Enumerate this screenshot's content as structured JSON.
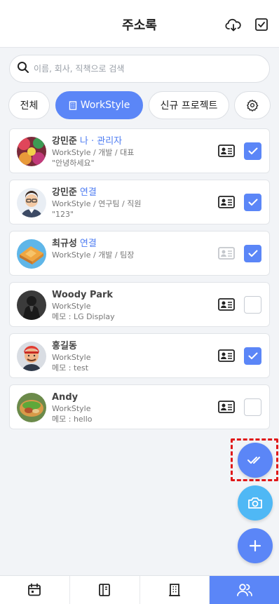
{
  "header": {
    "title": "주소록",
    "icons": [
      "cloud-download-icon",
      "checkbox-icon"
    ]
  },
  "search": {
    "placeholder": "이름, 회사, 직책으로 검색",
    "value": ""
  },
  "filters": [
    {
      "label": "전체",
      "active": false
    },
    {
      "label": "WorkStyle",
      "active": true,
      "icon": "building-icon"
    },
    {
      "label": "신규 프로젝트",
      "active": false
    },
    {
      "label": "",
      "icon": "gear-icon",
      "active": false
    }
  ],
  "contacts": [
    {
      "name": "강민준",
      "tag": "나 · 관리자",
      "line2": "WorkStyle / 개발 / 대표",
      "line3": "\"안녕하세요\"",
      "card_icon_active": true,
      "checked": true
    },
    {
      "name": "강민준",
      "tag": "연결",
      "line2": "WorkStyle / 연구팀 / 직원",
      "line3": "\"123\"",
      "card_icon_active": true,
      "checked": true
    },
    {
      "name": "최규성",
      "tag": "연결",
      "line2": "WorkStyle / 개발 / 팀장",
      "line3": "",
      "card_icon_active": false,
      "checked": true
    },
    {
      "name": "Woody Park",
      "tag": "",
      "line2": "WorkStyle",
      "line3": "메모 : LG Display",
      "card_icon_active": true,
      "checked": false
    },
    {
      "name": "홍길동",
      "tag": "",
      "line2": "WorkStyle",
      "line3": "메모 : test",
      "card_icon_active": true,
      "checked": true
    },
    {
      "name": "Andy",
      "tag": "",
      "line2": "WorkStyle",
      "line3": "메모 : hello",
      "card_icon_active": true,
      "checked": false
    }
  ],
  "fabs": [
    "double-check-icon",
    "camera-icon",
    "plus-icon"
  ],
  "bottom_nav": [
    {
      "icon": "calendar-icon",
      "active": false
    },
    {
      "icon": "notebook-icon",
      "active": false
    },
    {
      "icon": "building-icon",
      "active": false
    },
    {
      "icon": "users-icon",
      "active": true
    }
  ],
  "colors": {
    "accent": "#5b86f7",
    "tag": "#4f7df2",
    "highlight": "#e01818",
    "camera_fab": "#4fb8f5"
  }
}
